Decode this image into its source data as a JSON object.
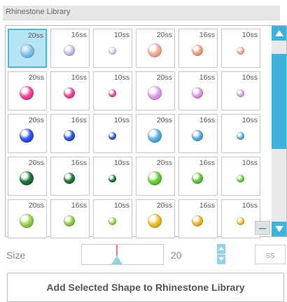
{
  "panel": {
    "title": "Rhinestone Library"
  },
  "library": {
    "selected_index": 0,
    "tiles": [
      {
        "size": "20ss",
        "color": "#8ac6ea",
        "dark": "#3a8fc4"
      },
      {
        "size": "16ss",
        "color": "#c9c9ef",
        "dark": "#7c7cc4"
      },
      {
        "size": "10ss",
        "color": "#d6d6ee",
        "dark": "#8e8eb6"
      },
      {
        "size": "20ss",
        "color": "#f3b19c",
        "dark": "#d9765a"
      },
      {
        "size": "16ss",
        "color": "#f0a58e",
        "dark": "#cc6a52"
      },
      {
        "size": "10ss",
        "color": "#f4b19c",
        "dark": "#d67d60"
      },
      {
        "size": "20ss",
        "color": "#f04fa0",
        "dark": "#b3125f"
      },
      {
        "size": "16ss",
        "color": "#f0509c",
        "dark": "#b5165c"
      },
      {
        "size": "10ss",
        "color": "#f15aa2",
        "dark": "#b81f62"
      },
      {
        "size": "20ss",
        "color": "#e2a6ec",
        "dark": "#b05bc4"
      },
      {
        "size": "16ss",
        "color": "#df9fe9",
        "dark": "#aa55bf"
      },
      {
        "size": "10ss",
        "color": "#e3a8ee",
        "dark": "#b05bc4"
      },
      {
        "size": "20ss",
        "color": "#2f57f5",
        "dark": "#0a2bb8"
      },
      {
        "size": "16ss",
        "color": "#3059f2",
        "dark": "#0c2cb8"
      },
      {
        "size": "10ss",
        "color": "#3861f2",
        "dark": "#0f30b8"
      },
      {
        "size": "20ss",
        "color": "#5fb4e6",
        "dark": "#1d78b4"
      },
      {
        "size": "16ss",
        "color": "#5cb1e4",
        "dark": "#1c74b0"
      },
      {
        "size": "10ss",
        "color": "#62b6e7",
        "dark": "#1f79b3"
      },
      {
        "size": "20ss",
        "color": "#1e7a3a",
        "dark": "#063d16"
      },
      {
        "size": "16ss",
        "color": "#227c3d",
        "dark": "#07411a"
      },
      {
        "size": "10ss",
        "color": "#2a8244",
        "dark": "#0a461d"
      },
      {
        "size": "20ss",
        "color": "#6ed03e",
        "dark": "#2f8a10"
      },
      {
        "size": "16ss",
        "color": "#6acb3c",
        "dark": "#2d8512"
      },
      {
        "size": "10ss",
        "color": "#75d346",
        "dark": "#338d17"
      },
      {
        "size": "20ss",
        "color": "#9ad84c",
        "dark": "#58921a"
      },
      {
        "size": "16ss",
        "color": "#95d34a",
        "dark": "#548c19"
      },
      {
        "size": "10ss",
        "color": "#9bd84f",
        "dark": "#5a951d"
      },
      {
        "size": "20ss",
        "color": "#f0c232",
        "dark": "#b07d05"
      },
      {
        "size": "16ss",
        "color": "#eebe2f",
        "dark": "#ad7905"
      },
      {
        "size": "10ss",
        "color": "#f2c53a",
        "dark": "#b38008"
      }
    ]
  },
  "size_control": {
    "label": "Size",
    "value": "20",
    "unit": "ss"
  },
  "actions": {
    "add_label": "Add Selected Shape to Rhinestone Library"
  }
}
